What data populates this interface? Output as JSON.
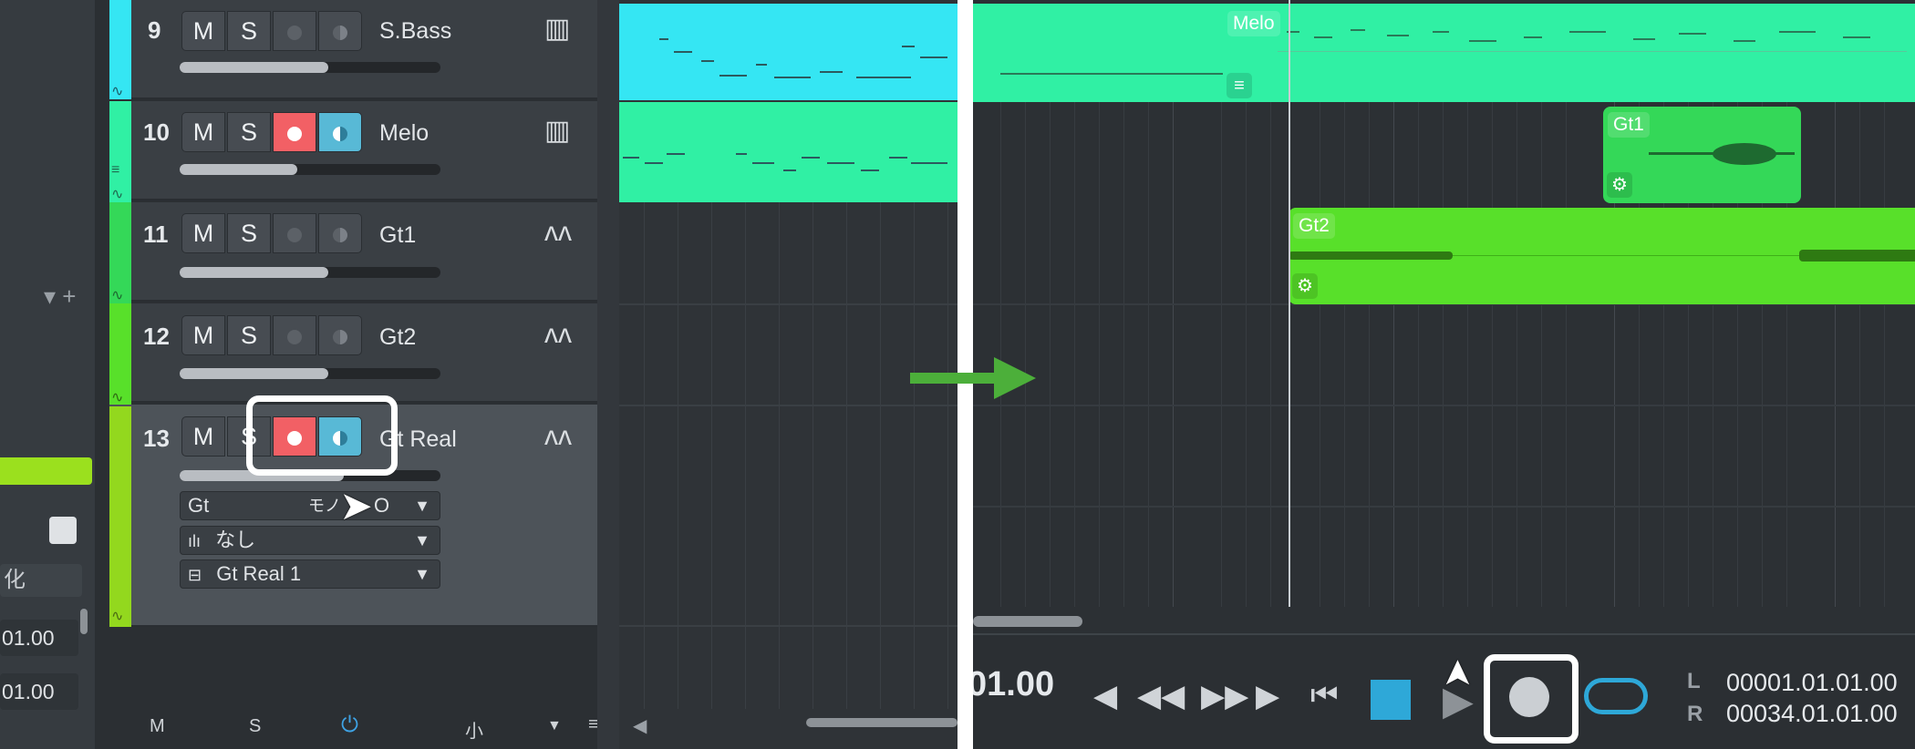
{
  "left_sidebar": {
    "field_label": "化",
    "values": [
      "01.00",
      "01.00"
    ]
  },
  "tracks": [
    {
      "number": "9",
      "name": "S.Bass",
      "mute": "M",
      "solo": "S",
      "color": "#35e6f3",
      "rec_active": false,
      "monitor_active": false,
      "icon": "keyboard-icon",
      "fader": 0.57
    },
    {
      "number": "10",
      "name": "Melo",
      "mute": "M",
      "solo": "S",
      "color": "#30f0a4",
      "rec_active": true,
      "monitor_active": true,
      "icon": "keyboard-icon",
      "fader": 0.45
    },
    {
      "number": "11",
      "name": "Gt1",
      "mute": "M",
      "solo": "S",
      "color": "#34d858",
      "rec_active": false,
      "monitor_active": false,
      "icon": "waveform-icon",
      "fader": 0.57
    },
    {
      "number": "12",
      "name": "Gt2",
      "mute": "M",
      "solo": "S",
      "color": "#58e02a",
      "rec_active": false,
      "monitor_active": false,
      "icon": "waveform-icon",
      "fader": 0.57
    },
    {
      "number": "13",
      "name": "Gt Real",
      "mute": "M",
      "solo": "S",
      "color": "#93d81e",
      "rec_active": true,
      "monitor_active": true,
      "icon": "waveform-icon",
      "fader": 0.63
    }
  ],
  "selected_track_options": {
    "input": "Gt",
    "input_mode": "モノ",
    "input_extra": "O",
    "plugin": "なし",
    "output": "Gt Real 1"
  },
  "track_footer": {
    "mute": "M",
    "solo": "S",
    "size": "小"
  },
  "arrange_right": {
    "clips": [
      {
        "name": "Melo",
        "color": "#30f0a4"
      },
      {
        "name": "Gt1",
        "color": "#34d858"
      },
      {
        "name": "Gt2",
        "color": "#58e02a"
      }
    ]
  },
  "transport": {
    "time_partial": "01.00",
    "left_label": "L",
    "right_label": "R",
    "left_locator": "00001.01.01.00",
    "right_locator": "00034.01.01.00"
  },
  "colors": {
    "accent_record": "#f26065",
    "accent_monitor": "#58b9d6",
    "stop": "#2ea8d8",
    "arrow": "#4caf3a"
  }
}
